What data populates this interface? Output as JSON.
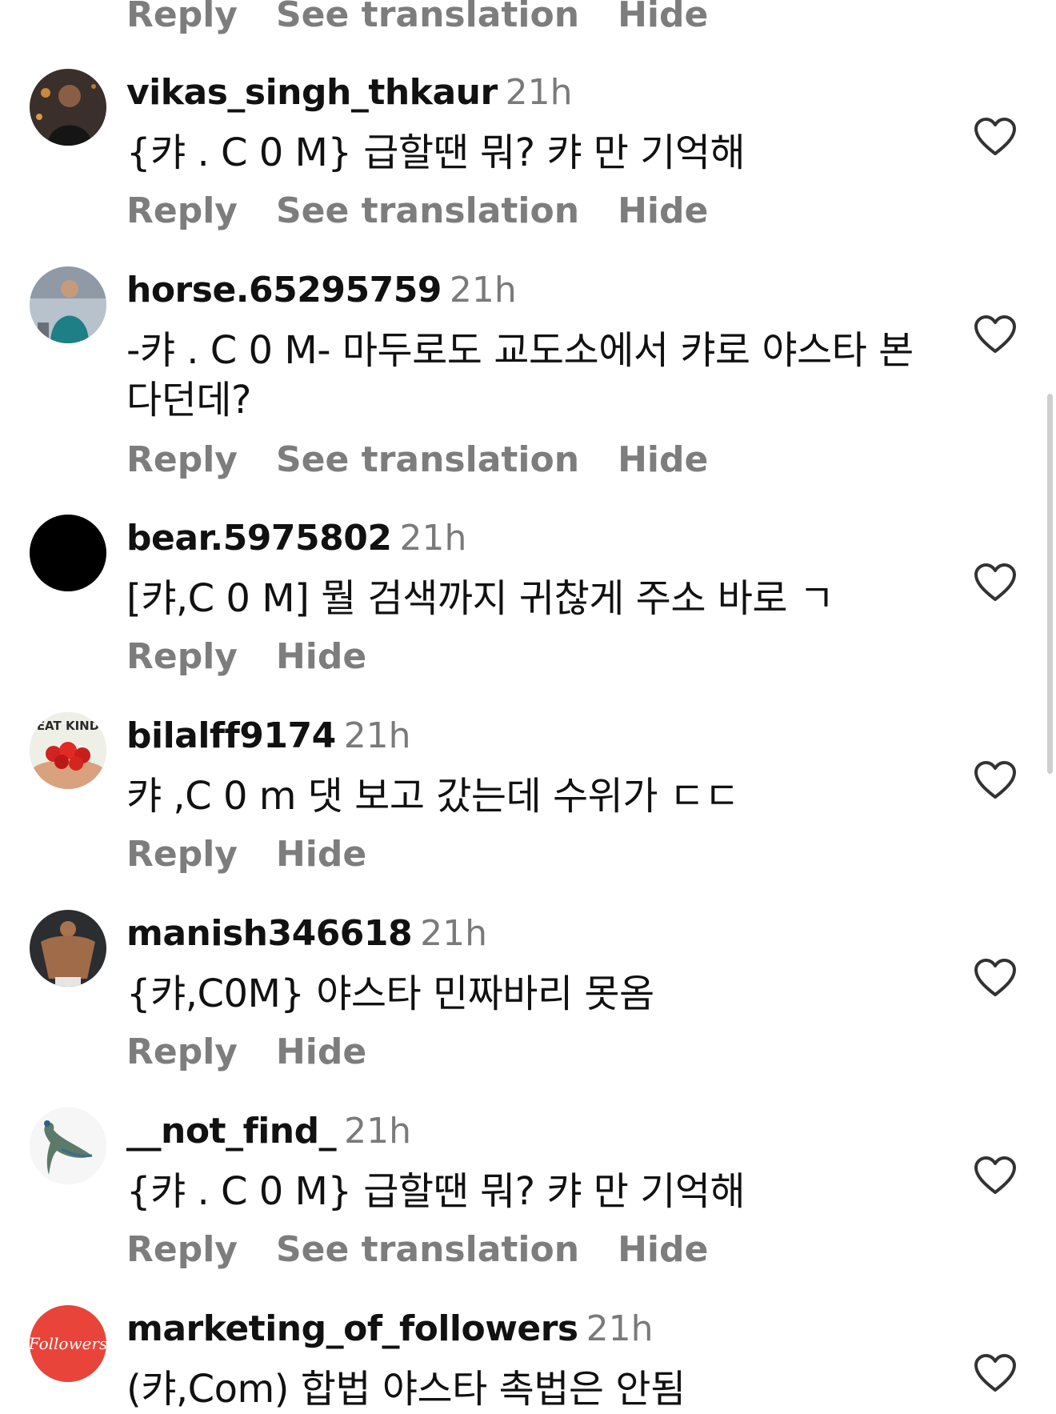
{
  "top_actions": {
    "reply": "Reply",
    "see_translation": "See translation",
    "hide": "Hide"
  },
  "comments": [
    {
      "username": "vikas_singh_thkaur",
      "time": "21h",
      "text": "{캬 . C 0 M} 급할땐 뭐? 캬 만 기억해",
      "actions": {
        "reply": "Reply",
        "see_translation": "See translation",
        "hide": "Hide"
      },
      "avatar_icon": "avatar-person-dark"
    },
    {
      "username": "horse.65295759",
      "time": "21h",
      "text": "-캬 . C 0 M- 마두로도 교도소에서 캬로 야스타 본다던데?",
      "actions": {
        "reply": "Reply",
        "see_translation": "See translation",
        "hide": "Hide"
      },
      "avatar_icon": "avatar-person-teal-hoodie"
    },
    {
      "username": "bear.5975802",
      "time": "21h",
      "text": "[캬,C 0 M] 뭘 검색까지 귀찮게 주소 바로 ㄱ",
      "actions": {
        "reply": "Reply",
        "hide": "Hide"
      },
      "avatar_icon": "avatar-black-circle"
    },
    {
      "username": "bilalff9174",
      "time": "21h",
      "text": "캬 ,C 0 m 댓 보고 갔는데 수위가 ㄷㄷ",
      "actions": {
        "reply": "Reply",
        "hide": "Hide"
      },
      "avatar_icon": "avatar-strawberries",
      "avatar_caption": "EAT KIND"
    },
    {
      "username": "manish346618",
      "time": "21h",
      "text": "{캬,C0M} 야스타 민짜바리 못옴",
      "actions": {
        "reply": "Reply",
        "hide": "Hide"
      },
      "avatar_icon": "avatar-shirtless-person"
    },
    {
      "username": "__not_find_",
      "time": "21h",
      "text": "{캬 . C 0 M} 급할땐 뭐? 캬 만 기억해",
      "actions": {
        "reply": "Reply",
        "see_translation": "See translation",
        "hide": "Hide"
      },
      "avatar_icon": "avatar-peacock"
    },
    {
      "username": "marketing_of_followers",
      "time": "21h",
      "text": "(캬,Com) 합법 야스타 촉법은 안됨",
      "actions": {},
      "avatar_icon": "avatar-followers-logo",
      "avatar_caption": "Followers"
    }
  ],
  "colors": {
    "username": "#111111",
    "meta": "#7d7d7d",
    "heart": "#333333",
    "followers_red": "#e8443a"
  },
  "icons": {
    "like": "heart-outline-icon"
  }
}
